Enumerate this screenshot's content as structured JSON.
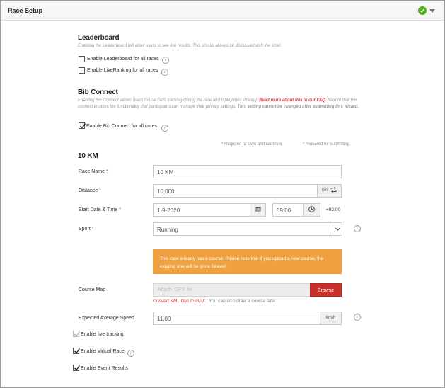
{
  "header": {
    "title": "Race Setup"
  },
  "leaderboard": {
    "title": "Leaderboard",
    "description": "Enabling the Leaderboard will allow users to see live results. This should always be discussed with the timer.",
    "options": [
      {
        "label": "Enable Leaderboard for all races",
        "checked": false
      },
      {
        "label": "Enable LiveRanking for all races",
        "checked": false
      }
    ]
  },
  "bib_connect": {
    "title": "Bib Connect",
    "description_pre": "Enabling Bib Connect allows users to use GPS tracking during the race and (split)times sharing. ",
    "description_link": "Read more about this in our FAQ.",
    "description_post": " Next to that Bib connect enables the functionality that participants can manage their privacy settings. ",
    "description_bold": "This setting cannot be changed after submitting this wizard.",
    "option": {
      "label": "Enable Bib Connect for all races",
      "checked": true
    }
  },
  "requirements": {
    "save": "Required to save and continue",
    "submit": "Required for submitting.",
    "star": "*"
  },
  "race": {
    "title": "10 KM",
    "name_label": "Race Name",
    "name_value": "10 KM",
    "distance_label": "Distance",
    "distance_value": "10,000",
    "distance_unit": "km",
    "start_label": "Start Date & Time",
    "start_date": "1-9-2020",
    "start_time": "09:00",
    "timezone": "+02:00",
    "sport_label": "Sport",
    "sport_value": "Running",
    "course_alert": "This race already has a course. Please note that if you upload a new course, the existing one will be gone forever!",
    "course_label": "Course Map",
    "course_placeholder": "Attach .GPX file",
    "browse_label": "Browse",
    "convert_link": "Convert KML files to GPX",
    "convert_rest": " | You can also draw a course later",
    "speed_label": "Expected Average Speed",
    "speed_value": "11,00",
    "speed_unit": "km/h",
    "toggles": [
      {
        "label": "Enable live tracking",
        "checked": true,
        "disabled": true
      },
      {
        "label": "Enable Virtual Race",
        "checked": true,
        "disabled": false
      },
      {
        "label": "Enable Event Results",
        "checked": true,
        "disabled": false
      }
    ]
  }
}
